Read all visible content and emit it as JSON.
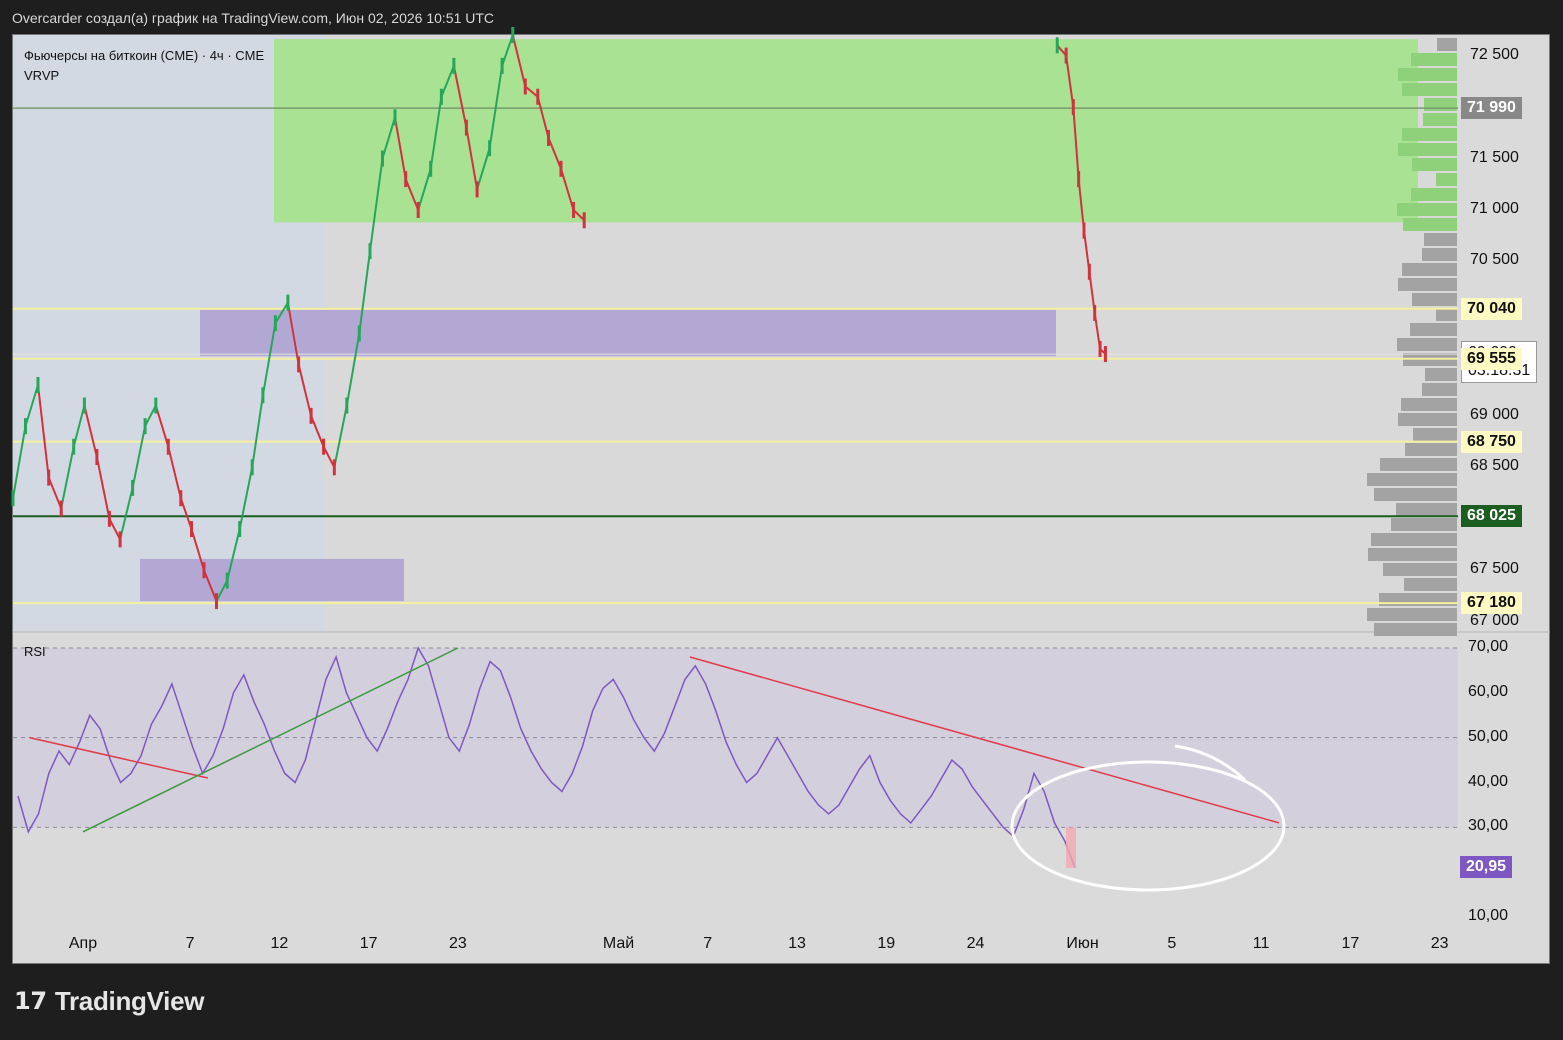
{
  "header": {
    "title": "Overcarder создал(а) график на TradingView.com, Июн 02, 2026 10:51 UTC"
  },
  "legend": {
    "symbol_line": "Фьючерсы на биткоин (CME) · 4ч · CME",
    "indicator": "VRVP",
    "rsi": "RSI"
  },
  "brand": {
    "name": "TradingView",
    "logo_icon": "tradingview-logo-icon"
  },
  "chart_data": [
    {
      "type": "line",
      "title": "Фьючерсы на биткоин (CME) · 4ч · CME",
      "ylim": [
        66900,
        72700
      ],
      "price_ticks": [
        "72 500",
        "71 500",
        "71 000",
        "70 500",
        "69 000",
        "68 500",
        "67 500",
        "67 000"
      ],
      "price_tick_values": [
        72500,
        71500,
        71000,
        70500,
        69000,
        68500,
        67500,
        67000
      ],
      "tags": [
        {
          "label": "71 990",
          "value": 71990,
          "bg": "#888888",
          "fg": "#ffffff"
        },
        {
          "label": "70 040",
          "value": 70040,
          "bg": "#fff9c4",
          "fg": "#111111"
        },
        {
          "label": "69 600",
          "value": 69600,
          "bg": "#ffffff",
          "fg": "#111111",
          "sub": "03:18:31"
        },
        {
          "label": "69 555",
          "value": 69555,
          "bg": "#fff9c4",
          "fg": "#111111"
        },
        {
          "label": "68 750",
          "value": 68750,
          "bg": "#fff9c4",
          "fg": "#111111"
        },
        {
          "label": "68 025",
          "value": 68025,
          "bg": "#1b5e20",
          "fg": "#ffffff"
        },
        {
          "label": "67 180",
          "value": 67180,
          "bg": "#fff9c4",
          "fg": "#111111"
        }
      ],
      "zones": [
        {
          "name": "green-zone",
          "from": 70880,
          "to": 72660,
          "color": "#a8e292"
        },
        {
          "name": "purple-zone-upper",
          "from": 69580,
          "to": 70030,
          "color": "#b3a8d3"
        },
        {
          "name": "purple-zone-lower",
          "from": 67200,
          "to": 67610,
          "color": "#b3a8d3"
        }
      ],
      "close_series": [
        68200,
        68900,
        69300,
        68400,
        68100,
        68700,
        69100,
        68600,
        68000,
        67800,
        68300,
        68900,
        69100,
        68700,
        68200,
        67900,
        67500,
        67200,
        67400,
        67900,
        68500,
        69200,
        69900,
        70100,
        69500,
        69000,
        68700,
        68500,
        69100,
        69800,
        70600,
        71500,
        71900,
        71300,
        71000,
        71400,
        72100,
        72400,
        71800,
        71200,
        71600,
        72400,
        72700,
        72200,
        72100,
        71700,
        71400,
        71000,
        70900,
        72600,
        72500,
        72000,
        71300,
        70800,
        70400,
        70000,
        69650,
        69600
      ],
      "close_x_days": [
        0,
        0.7,
        1.4,
        2,
        2.7,
        3.4,
        4,
        4.7,
        5.4,
        6,
        6.7,
        7.4,
        8,
        8.7,
        9.4,
        10,
        10.7,
        11.4,
        12,
        12.7,
        13.4,
        14,
        14.7,
        15.4,
        16,
        16.7,
        17.4,
        18,
        18.7,
        19.4,
        20,
        20.7,
        21.4,
        22,
        22.7,
        23.4,
        24,
        24.7,
        25.4,
        26,
        26.7,
        27.4,
        28,
        28.7,
        29.4,
        30,
        30.7,
        31.4,
        32,
        58.5,
        59,
        59.4,
        59.7,
        60,
        60.3,
        60.6,
        60.9,
        61.2
      ]
    },
    {
      "type": "line",
      "title": "RSI",
      "ylim": [
        5,
        72
      ],
      "ticks": [
        "70,00",
        "60,00",
        "50,00",
        "40,00",
        "30,00",
        "10,00"
      ],
      "tick_values": [
        70,
        60,
        50,
        40,
        30,
        10
      ],
      "band": [
        30,
        70
      ],
      "last_label": "20,95",
      "last_value": 20.95,
      "values": [
        37,
        29,
        33,
        42,
        47,
        44,
        49,
        55,
        52,
        45,
        40,
        42,
        46,
        53,
        57,
        62,
        55,
        48,
        42,
        46,
        52,
        60,
        64,
        58,
        53,
        47,
        42,
        40,
        45,
        54,
        63,
        68,
        60,
        55,
        50,
        47,
        52,
        58,
        63,
        70,
        66,
        58,
        50,
        47,
        53,
        61,
        67,
        65,
        59,
        52,
        47,
        43,
        40,
        38,
        42,
        48,
        56,
        61,
        63,
        59,
        54,
        50,
        47,
        51,
        57,
        63,
        66,
        62,
        56,
        49,
        44,
        40,
        42,
        46,
        50,
        46,
        42,
        38,
        35,
        33,
        35,
        39,
        43,
        46,
        40,
        36,
        33,
        31,
        34,
        37,
        41,
        45,
        43,
        39,
        36,
        33,
        30,
        28,
        34,
        42,
        38,
        31,
        27,
        21
      ],
      "date_labels": [
        "Апр",
        "7",
        "12",
        "17",
        "23",
        "Май",
        "7",
        "13",
        "19",
        "24",
        "Июн",
        "5",
        "11",
        "17",
        "23"
      ],
      "date_label_days": [
        0,
        6,
        11,
        16,
        21,
        30,
        35,
        40,
        45,
        50,
        56,
        61,
        66,
        71,
        76
      ],
      "trendlines": [
        {
          "name": "red-trendline-left",
          "color": "#e23b4a",
          "from": [
            -3,
            50
          ],
          "to": [
            7,
            41
          ]
        },
        {
          "name": "green-trendline",
          "color": "#3c9a3c",
          "from": [
            0,
            29
          ],
          "to": [
            21,
            70
          ]
        },
        {
          "name": "red-trendline-right",
          "color": "#e23b4a",
          "from": [
            34,
            68
          ],
          "to": [
            67,
            31
          ]
        }
      ]
    }
  ]
}
